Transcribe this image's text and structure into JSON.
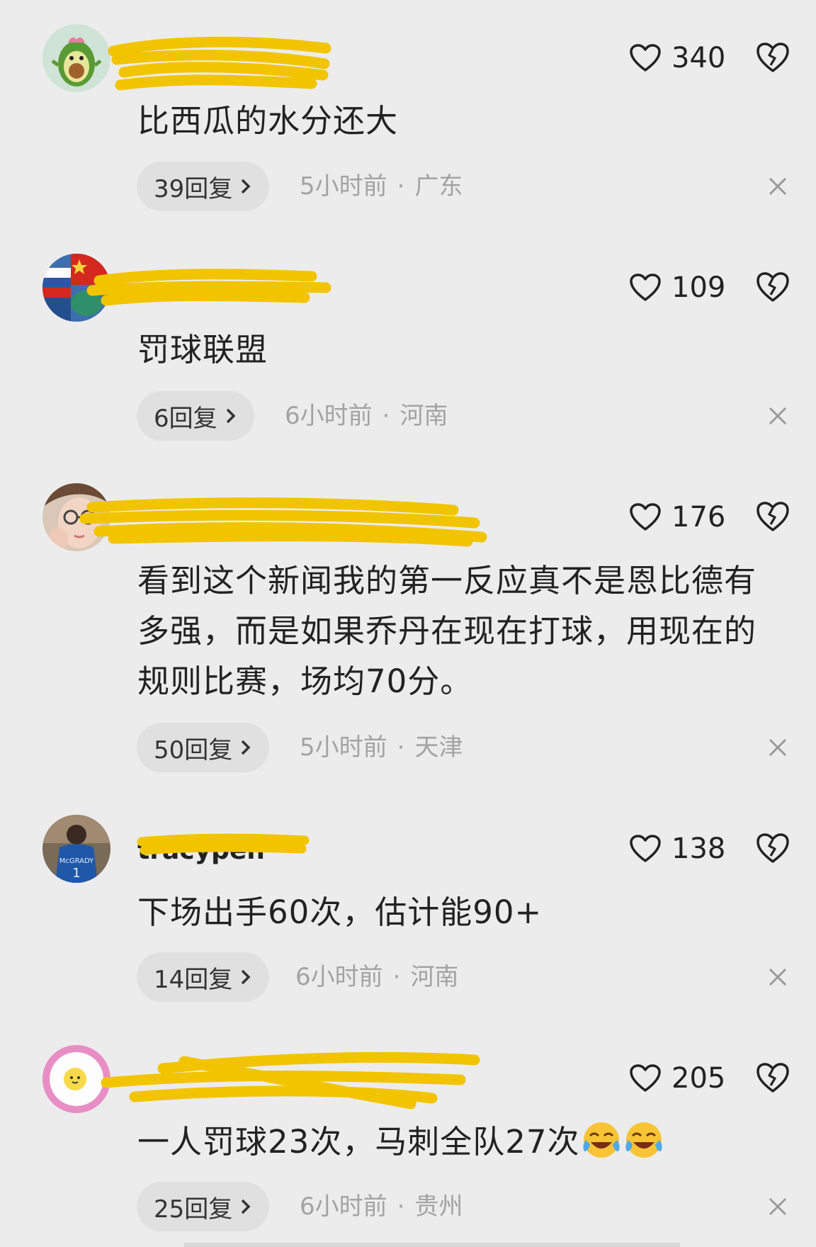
{
  "comments": [
    {
      "username": "",
      "likes": "340",
      "text": "比西瓜的水分还大",
      "replies": "39回复",
      "time": "5小时前",
      "region": "广东",
      "avatar": "avocado-avatar"
    },
    {
      "username": "",
      "likes": "109",
      "text": "罚球联盟",
      "replies": "6回复",
      "time": "6小时前",
      "region": "河南",
      "avatar": "flags-avatar"
    },
    {
      "username": "",
      "likes": "176",
      "text_lines": [
        "看到这个新闻我的第一反应真不是恩比德有",
        "多强，而是如果乔丹在现在打球，用现在的",
        "规则比赛，场均70分。"
      ],
      "replies": "50回复",
      "time": "5小时前",
      "region": "天津",
      "avatar": "girl-avatar"
    },
    {
      "username": "tracypen",
      "likes": "138",
      "text": "下场出手60次，估计能90+",
      "replies": "14回复",
      "time": "6小时前",
      "region": "河南",
      "avatar": "basketball-player-avatar"
    },
    {
      "username": "",
      "likes": "205",
      "text": "一人罚球23次，马刺全队27次",
      "emojis": [
        "laughing-crying-emoji",
        "laughing-crying-emoji"
      ],
      "replies": "25回复",
      "time": "6小时前",
      "region": "贵州",
      "avatar": "egg-avatar"
    }
  ],
  "separator": "·",
  "colors": {
    "background": "#ececec",
    "pill": "#e0e0e0",
    "meta_text": "#a3a3a3",
    "redaction": "#f2c400"
  }
}
